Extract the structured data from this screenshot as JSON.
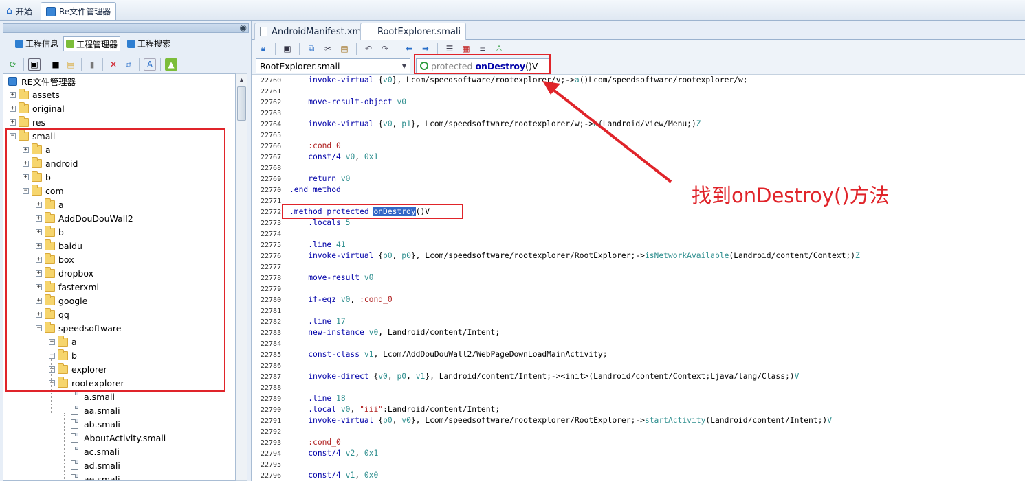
{
  "top_tabs": [
    {
      "label": "开始"
    },
    {
      "label": "Re文件管理器"
    }
  ],
  "left_panel": {
    "tabs": [
      {
        "label": "工程信息"
      },
      {
        "label": "工程管理器"
      },
      {
        "label": "工程搜索"
      }
    ],
    "toolbar_icons": [
      "refresh-icon",
      "image-icon",
      "window-icon",
      "search-folder-icon",
      "book-icon",
      "delete-icon",
      "copy-icon",
      "text-icon",
      "android-icon"
    ],
    "tree": [
      {
        "label": "RE文件管理器",
        "level": 0,
        "type": "root"
      },
      {
        "label": "assets",
        "level": 0,
        "type": "folder",
        "state": "collapsed"
      },
      {
        "label": "original",
        "level": 0,
        "type": "folder",
        "state": "collapsed"
      },
      {
        "label": "res",
        "level": 0,
        "type": "folder",
        "state": "collapsed"
      },
      {
        "label": "smali",
        "level": 0,
        "type": "folder",
        "state": "expanded"
      },
      {
        "label": "a",
        "level": 1,
        "type": "folder",
        "state": "collapsed"
      },
      {
        "label": "android",
        "level": 1,
        "type": "folder",
        "state": "collapsed"
      },
      {
        "label": "b",
        "level": 1,
        "type": "folder",
        "state": "collapsed"
      },
      {
        "label": "com",
        "level": 1,
        "type": "folder",
        "state": "expanded"
      },
      {
        "label": "a",
        "level": 2,
        "type": "folder",
        "state": "collapsed"
      },
      {
        "label": "AddDouDouWall2",
        "level": 2,
        "type": "folder",
        "state": "collapsed"
      },
      {
        "label": "b",
        "level": 2,
        "type": "folder",
        "state": "collapsed"
      },
      {
        "label": "baidu",
        "level": 2,
        "type": "folder",
        "state": "collapsed"
      },
      {
        "label": "box",
        "level": 2,
        "type": "folder",
        "state": "collapsed"
      },
      {
        "label": "dropbox",
        "level": 2,
        "type": "folder",
        "state": "collapsed"
      },
      {
        "label": "fasterxml",
        "level": 2,
        "type": "folder",
        "state": "collapsed"
      },
      {
        "label": "google",
        "level": 2,
        "type": "folder",
        "state": "collapsed"
      },
      {
        "label": "qq",
        "level": 2,
        "type": "folder",
        "state": "collapsed"
      },
      {
        "label": "speedsoftware",
        "level": 2,
        "type": "folder",
        "state": "expanded"
      },
      {
        "label": "a",
        "level": 3,
        "type": "folder",
        "state": "collapsed"
      },
      {
        "label": "b",
        "level": 3,
        "type": "folder",
        "state": "collapsed"
      },
      {
        "label": "explorer",
        "level": 3,
        "type": "folder",
        "state": "collapsed"
      },
      {
        "label": "rootexplorer",
        "level": 3,
        "type": "folder",
        "state": "expanded"
      },
      {
        "label": "a.smali",
        "level": 4,
        "type": "file"
      },
      {
        "label": "aa.smali",
        "level": 4,
        "type": "file"
      },
      {
        "label": "ab.smali",
        "level": 4,
        "type": "file"
      },
      {
        "label": "AboutActivity.smali",
        "level": 4,
        "type": "file"
      },
      {
        "label": "ac.smali",
        "level": 4,
        "type": "file"
      },
      {
        "label": "ad.smali",
        "level": 4,
        "type": "file"
      },
      {
        "label": "ae.smali",
        "level": 4,
        "type": "file"
      }
    ]
  },
  "editor": {
    "tabs": [
      {
        "label": "AndroidManifest.xml"
      },
      {
        "label": "RootExplorer.smali"
      }
    ],
    "toolbar_icons": [
      "lock-icon",
      "save-icon",
      "copy-icon",
      "cut-icon",
      "paste-icon",
      "undo-icon",
      "redo-icon",
      "back-icon",
      "forward-icon",
      "format-icon",
      "compile-icon",
      "list-icon",
      "debug-icon"
    ],
    "class_combo": "RootExplorer.smali",
    "method_combo": {
      "modifier": "protected",
      "name": "onDestroy",
      "signature": "()V"
    },
    "lines": [
      {
        "n": "22760",
        "segs": [
          [
            "    ",
            ""
          ],
          [
            "invoke-virtual",
            "kw"
          ],
          [
            " {",
            ""
          ],
          [
            "v0",
            "reg"
          ],
          [
            "}, Lcom/speedsoftware/rootexplorer/v;->",
            ""
          ],
          [
            "a",
            "mth"
          ],
          [
            "()Lcom/speedsoftware/rootexplorer/w;",
            ""
          ]
        ]
      },
      {
        "n": "22761",
        "segs": []
      },
      {
        "n": "22762",
        "segs": [
          [
            "    ",
            ""
          ],
          [
            "move-result-object",
            "kw"
          ],
          [
            " ",
            ""
          ],
          [
            "v0",
            "reg"
          ]
        ]
      },
      {
        "n": "22763",
        "segs": []
      },
      {
        "n": "22764",
        "segs": [
          [
            "    ",
            ""
          ],
          [
            "invoke-virtual",
            "kw"
          ],
          [
            " {",
            ""
          ],
          [
            "v0",
            "reg"
          ],
          [
            ", ",
            ""
          ],
          [
            "p1",
            "reg"
          ],
          [
            "}, Lcom/speedsoftware/rootexplorer/w;->",
            ""
          ],
          [
            "a",
            "mth"
          ],
          [
            "(Landroid/view/Menu;)",
            ""
          ],
          [
            "Z",
            "mth"
          ]
        ]
      },
      {
        "n": "22765",
        "segs": []
      },
      {
        "n": "22766",
        "segs": [
          [
            "    ",
            ""
          ],
          [
            ":cond_0",
            "lbl"
          ]
        ]
      },
      {
        "n": "22767",
        "segs": [
          [
            "    ",
            ""
          ],
          [
            "const/4",
            "kw"
          ],
          [
            " ",
            ""
          ],
          [
            "v0",
            "reg"
          ],
          [
            ", ",
            ""
          ],
          [
            "0x1",
            "reg"
          ]
        ]
      },
      {
        "n": "22768",
        "segs": []
      },
      {
        "n": "22769",
        "segs": [
          [
            "    ",
            ""
          ],
          [
            "return",
            "kw"
          ],
          [
            " ",
            ""
          ],
          [
            "v0",
            "reg"
          ]
        ]
      },
      {
        "n": "22770",
        "segs": [
          [
            ".end method",
            "kw"
          ]
        ]
      },
      {
        "n": "22771",
        "segs": []
      },
      {
        "n": "22772",
        "segs": [
          [
            ".method protected ",
            "kw"
          ],
          [
            "onDestroy",
            "hl"
          ],
          [
            "()V",
            ""
          ]
        ]
      },
      {
        "n": "22773",
        "segs": [
          [
            "    ",
            ""
          ],
          [
            ".locals",
            "kw"
          ],
          [
            " ",
            ""
          ],
          [
            "5",
            "reg"
          ]
        ]
      },
      {
        "n": "22774",
        "segs": []
      },
      {
        "n": "22775",
        "segs": [
          [
            "    ",
            ""
          ],
          [
            ".line",
            "kw"
          ],
          [
            " ",
            ""
          ],
          [
            "41",
            "reg"
          ]
        ]
      },
      {
        "n": "22776",
        "segs": [
          [
            "    ",
            ""
          ],
          [
            "invoke-virtual",
            "kw"
          ],
          [
            " {",
            ""
          ],
          [
            "p0",
            "reg"
          ],
          [
            ", ",
            ""
          ],
          [
            "p0",
            "reg"
          ],
          [
            "}, Lcom/speedsoftware/rootexplorer/RootExplorer;->",
            ""
          ],
          [
            "isNetworkAvailable",
            "mth"
          ],
          [
            "(Landroid/content/Context;)",
            ""
          ],
          [
            "Z",
            "mth"
          ]
        ]
      },
      {
        "n": "22777",
        "segs": []
      },
      {
        "n": "22778",
        "segs": [
          [
            "    ",
            ""
          ],
          [
            "move-result",
            "kw"
          ],
          [
            " ",
            ""
          ],
          [
            "v0",
            "reg"
          ]
        ]
      },
      {
        "n": "22779",
        "segs": []
      },
      {
        "n": "22780",
        "segs": [
          [
            "    ",
            ""
          ],
          [
            "if-eqz",
            "kw"
          ],
          [
            " ",
            ""
          ],
          [
            "v0",
            "reg"
          ],
          [
            ", ",
            ""
          ],
          [
            ":cond_0",
            "lbl"
          ]
        ]
      },
      {
        "n": "22781",
        "segs": []
      },
      {
        "n": "22782",
        "segs": [
          [
            "    ",
            ""
          ],
          [
            ".line",
            "kw"
          ],
          [
            " ",
            ""
          ],
          [
            "17",
            "reg"
          ]
        ]
      },
      {
        "n": "22783",
        "segs": [
          [
            "    ",
            ""
          ],
          [
            "new-instance",
            "kw"
          ],
          [
            " ",
            ""
          ],
          [
            "v0",
            "reg"
          ],
          [
            ", Landroid/content/Intent;",
            ""
          ]
        ]
      },
      {
        "n": "22784",
        "segs": []
      },
      {
        "n": "22785",
        "segs": [
          [
            "    ",
            ""
          ],
          [
            "const-class",
            "kw"
          ],
          [
            " ",
            ""
          ],
          [
            "v1",
            "reg"
          ],
          [
            ", Lcom/AddDouDouWall2/WebPageDownLoadMainActivity;",
            ""
          ]
        ]
      },
      {
        "n": "22786",
        "segs": []
      },
      {
        "n": "22787",
        "segs": [
          [
            "    ",
            ""
          ],
          [
            "invoke-direct",
            "kw"
          ],
          [
            " {",
            ""
          ],
          [
            "v0",
            "reg"
          ],
          [
            ", ",
            ""
          ],
          [
            "p0",
            "reg"
          ],
          [
            ", ",
            ""
          ],
          [
            "v1",
            "reg"
          ],
          [
            "}, Landroid/content/Intent;-><init>",
            ""
          ],
          [
            "(Landroid/content/Context;Ljava/lang/Class;)",
            ""
          ],
          [
            "V",
            "mth"
          ]
        ]
      },
      {
        "n": "22788",
        "segs": []
      },
      {
        "n": "22789",
        "segs": [
          [
            "    ",
            ""
          ],
          [
            ".line",
            "kw"
          ],
          [
            " ",
            ""
          ],
          [
            "18",
            "reg"
          ]
        ]
      },
      {
        "n": "22790",
        "segs": [
          [
            "    ",
            ""
          ],
          [
            ".local",
            "kw"
          ],
          [
            " ",
            ""
          ],
          [
            "v0",
            "reg"
          ],
          [
            ", ",
            ""
          ],
          [
            "\"iii\"",
            "str"
          ],
          [
            ":Landroid/content/Intent;",
            ""
          ]
        ]
      },
      {
        "n": "22791",
        "segs": [
          [
            "    ",
            ""
          ],
          [
            "invoke-virtual",
            "kw"
          ],
          [
            " {",
            ""
          ],
          [
            "p0",
            "reg"
          ],
          [
            ", ",
            ""
          ],
          [
            "v0",
            "reg"
          ],
          [
            "}, Lcom/speedsoftware/rootexplorer/RootExplorer;->",
            ""
          ],
          [
            "startActivity",
            "mth"
          ],
          [
            "(Landroid/content/Intent;)",
            ""
          ],
          [
            "V",
            "mth"
          ]
        ]
      },
      {
        "n": "22792",
        "segs": []
      },
      {
        "n": "22793",
        "segs": [
          [
            "    ",
            ""
          ],
          [
            ":cond_0",
            "lbl"
          ]
        ]
      },
      {
        "n": "22794",
        "segs": [
          [
            "    ",
            ""
          ],
          [
            "const/4",
            "kw"
          ],
          [
            " ",
            ""
          ],
          [
            "v2",
            "reg"
          ],
          [
            ", ",
            ""
          ],
          [
            "0x1",
            "reg"
          ]
        ]
      },
      {
        "n": "22795",
        "segs": []
      },
      {
        "n": "22796",
        "segs": [
          [
            "    ",
            ""
          ],
          [
            "const/4",
            "kw"
          ],
          [
            " ",
            ""
          ],
          [
            "v1",
            "reg"
          ],
          [
            ", ",
            ""
          ],
          [
            "0x0",
            "reg"
          ]
        ]
      }
    ]
  },
  "annotation": "找到onDestroy()方法",
  "colors": {
    "accent_red": "#e0242a",
    "keyword": "#0000a8",
    "register": "#2f8f8f",
    "label": "#b02020",
    "selection": "#3468c6"
  }
}
